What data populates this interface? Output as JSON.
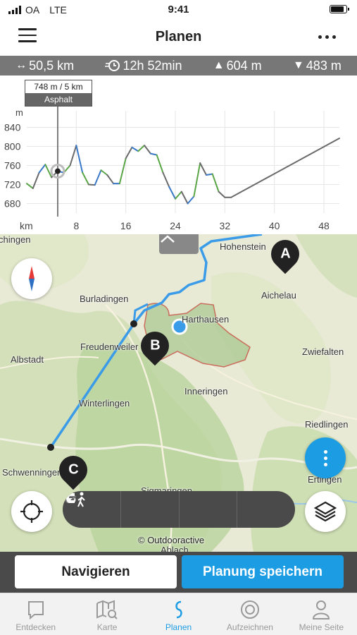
{
  "status_bar": {
    "carrier": "OA",
    "network": "LTE",
    "time": "9:41"
  },
  "header": {
    "title": "Planen"
  },
  "stats": {
    "distance": "50,5 km",
    "duration": "12h 52min",
    "ascent": "604 m",
    "descent": "483 m"
  },
  "chart": {
    "tooltip_value": "748 m / 5 km",
    "tooltip_surface": "Asphalt"
  },
  "chart_data": {
    "type": "line",
    "ylabel": "m",
    "xlabel": "km",
    "ylim": [
      660,
      860
    ],
    "xlim": [
      0,
      50.5
    ],
    "y_ticks": [
      "840",
      "800",
      "760",
      "720",
      "680"
    ],
    "x_ticks": [
      "8",
      "16",
      "24",
      "32",
      "40",
      "48"
    ],
    "cursor_x": 5,
    "series": [
      {
        "x": [
          0,
          1,
          2,
          3,
          4,
          5,
          6,
          7,
          8,
          9,
          10,
          11,
          12,
          13,
          14,
          15,
          16,
          17,
          18,
          19,
          20,
          21,
          22,
          23,
          24,
          25,
          26,
          27,
          28,
          29,
          30,
          31,
          32,
          33,
          50.5
        ],
        "y": [
          722,
          712,
          745,
          762,
          735,
          748,
          745,
          760,
          802,
          745,
          720,
          719,
          750,
          740,
          722,
          722,
          775,
          798,
          790,
          802,
          785,
          782,
          745,
          715,
          690,
          705,
          680,
          695,
          765,
          740,
          742,
          705,
          693,
          693,
          817
        ]
      }
    ]
  },
  "map": {
    "places": [
      "chingen",
      "Hohenstein",
      "Burladingen",
      "Harthausen",
      "Aichelau",
      "Freudenweiler",
      "Zwiefalten",
      "Albstadt",
      "Inneringen",
      "Winterlingen",
      "Riedlingen",
      "Schwenningen",
      "Ertingen",
      "Sigmaringen",
      "Ablach"
    ],
    "markers": [
      "A",
      "B",
      "C"
    ],
    "copyright": "© Outdooractive"
  },
  "actions": {
    "navigate": "Navigieren",
    "save": "Planung speichern"
  },
  "tabs": [
    {
      "label": "Entdecken",
      "icon": "chat-icon"
    },
    {
      "label": "Karte",
      "icon": "map-search-icon"
    },
    {
      "label": "Planen",
      "icon": "route-icon"
    },
    {
      "label": "Aufzeichnen",
      "icon": "record-icon"
    },
    {
      "label": "Meine Seite",
      "icon": "profile-icon"
    }
  ],
  "colors": {
    "accent": "#1c9ce3",
    "route": "#3a9be8",
    "area_border": "#c0392b"
  }
}
